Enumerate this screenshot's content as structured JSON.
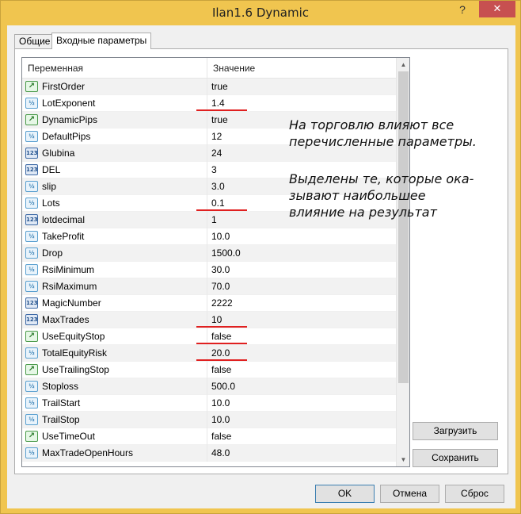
{
  "window": {
    "title": "Ilan1.6 Dynamic",
    "help_label": "?",
    "close_label": "✕"
  },
  "tabs": [
    {
      "label": "Общие"
    },
    {
      "label": "Входные параметры"
    }
  ],
  "grid": {
    "col_variable": "Переменная",
    "col_value": "Значение"
  },
  "rows": [
    {
      "type": "bool",
      "name": "FirstOrder",
      "value": "true"
    },
    {
      "type": "dbl",
      "name": "LotExponent",
      "value": "1.4"
    },
    {
      "type": "bool",
      "name": "DynamicPips",
      "value": "true"
    },
    {
      "type": "dbl",
      "name": "DefaultPips",
      "value": "12"
    },
    {
      "type": "int",
      "name": "Glubina",
      "value": "24"
    },
    {
      "type": "int",
      "name": "DEL",
      "value": "3"
    },
    {
      "type": "dbl",
      "name": "slip",
      "value": "3.0"
    },
    {
      "type": "dbl",
      "name": "Lots",
      "value": "0.1"
    },
    {
      "type": "int",
      "name": "lotdecimal",
      "value": "1"
    },
    {
      "type": "dbl",
      "name": "TakeProfit",
      "value": "10.0"
    },
    {
      "type": "dbl",
      "name": "Drop",
      "value": "1500.0"
    },
    {
      "type": "dbl",
      "name": "RsiMinimum",
      "value": "30.0"
    },
    {
      "type": "dbl",
      "name": "RsiMaximum",
      "value": "70.0"
    },
    {
      "type": "int",
      "name": "MagicNumber",
      "value": "2222"
    },
    {
      "type": "int",
      "name": "MaxTrades",
      "value": "10"
    },
    {
      "type": "bool",
      "name": "UseEquityStop",
      "value": "false"
    },
    {
      "type": "dbl",
      "name": "TotalEquityRisk",
      "value": "20.0"
    },
    {
      "type": "bool",
      "name": "UseTrailingStop",
      "value": "false"
    },
    {
      "type": "dbl",
      "name": "Stoploss",
      "value": "500.0"
    },
    {
      "type": "dbl",
      "name": "TrailStart",
      "value": "10.0"
    },
    {
      "type": "dbl",
      "name": "TrailStop",
      "value": "10.0"
    },
    {
      "type": "bool",
      "name": "UseTimeOut",
      "value": "false"
    },
    {
      "type": "dbl",
      "name": "MaxTradeOpenHours",
      "value": "48.0"
    }
  ],
  "type_labels": {
    "bool": "↗",
    "int": "123",
    "dbl": "½"
  },
  "highlighted_rows": [
    "LotExponent",
    "Lots",
    "MaxTrades",
    "UseEquityStop",
    "TotalEquityRisk"
  ],
  "annotation": {
    "line1": "На торговлю влияют все\nперечисленные параметры.",
    "line2": "Выделены те, которые ока-\nзывают наибольшее\nвлияние на результат"
  },
  "buttons": {
    "load": "Загрузить",
    "save": "Сохранить",
    "ok": "OK",
    "cancel": "Отмена",
    "reset": "Сброс"
  },
  "colors": {
    "titlebar": "#f0c54f",
    "close": "#c75050",
    "highlight_underline": "#e02020"
  }
}
